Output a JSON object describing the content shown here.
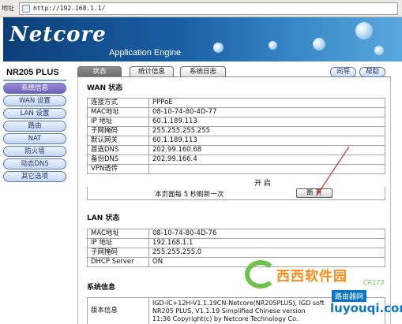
{
  "browser": {
    "address_label": "地址",
    "url": "http://192.168.1.1/"
  },
  "header": {
    "brand": "Netcore",
    "tagline": "Application Engine",
    "colors": {
      "banner_dark": "#0c3f78",
      "banner_light": "#5aa8dc"
    }
  },
  "sidebar": {
    "model": "NR205 PLUS",
    "items": [
      {
        "label": "系统信息",
        "active": true
      },
      {
        "label": "WAN 设置"
      },
      {
        "label": "LAN 设置"
      },
      {
        "label": "路由"
      },
      {
        "label": "NAT"
      },
      {
        "label": "防火墙"
      },
      {
        "label": "动态DNS"
      },
      {
        "label": "其它选项"
      }
    ]
  },
  "tabs": [
    {
      "label": "状态",
      "active": true
    },
    {
      "label": "统计信息"
    },
    {
      "label": "系统日志"
    }
  ],
  "header_buttons": {
    "wizard": "向导",
    "help": "帮助"
  },
  "wan": {
    "title": "WAN 状态",
    "rows": [
      {
        "key": "连接方式",
        "value": "PPPoE"
      },
      {
        "key": "MAC地址",
        "value": "08-10-74-80-4D-77"
      },
      {
        "key": "IP  地址",
        "value": "60.1.189.113"
      },
      {
        "key": "子网掩码",
        "value": "255.255.255.255"
      },
      {
        "key": "默认网关",
        "value": "60.1.189.113"
      },
      {
        "key": "首选DNS",
        "value": "202.99.160.68"
      },
      {
        "key": "备份DNS",
        "value": "202.99.166.4"
      },
      {
        "key": "VPN透传",
        "value": ""
      }
    ],
    "vpn_state": "开 启",
    "refresh_text": "本页面每 5 秒刷新一次",
    "disconnect_label": "断 开"
  },
  "lan": {
    "title": "LAN 状态",
    "rows": [
      {
        "key": "MAC地址",
        "value": "08-10-74-80-4D-76"
      },
      {
        "key": "IP  地址",
        "value": "192.168.1.1"
      },
      {
        "key": "子网掩码",
        "value": "255.255.255.0"
      },
      {
        "key": "DHCP Server",
        "value": "ON"
      }
    ]
  },
  "sysinfo": {
    "title": "系统信息",
    "version_key": "版本信息",
    "version_lines": [
      "IGD-IC+12H-V1.1.19CN-Netcore(NR205PLUS), IGD soft",
      "NR205 PLUS, V1.1.19 Simplified Chinese version",
      "11:36 Copyright(c) by Netcore Technology Co."
    ]
  },
  "watermarks": {
    "brand": "西西软件园",
    "brand_sub": "CR173",
    "site_cn": "路由器网",
    "site_en": "luyouqi.com"
  }
}
